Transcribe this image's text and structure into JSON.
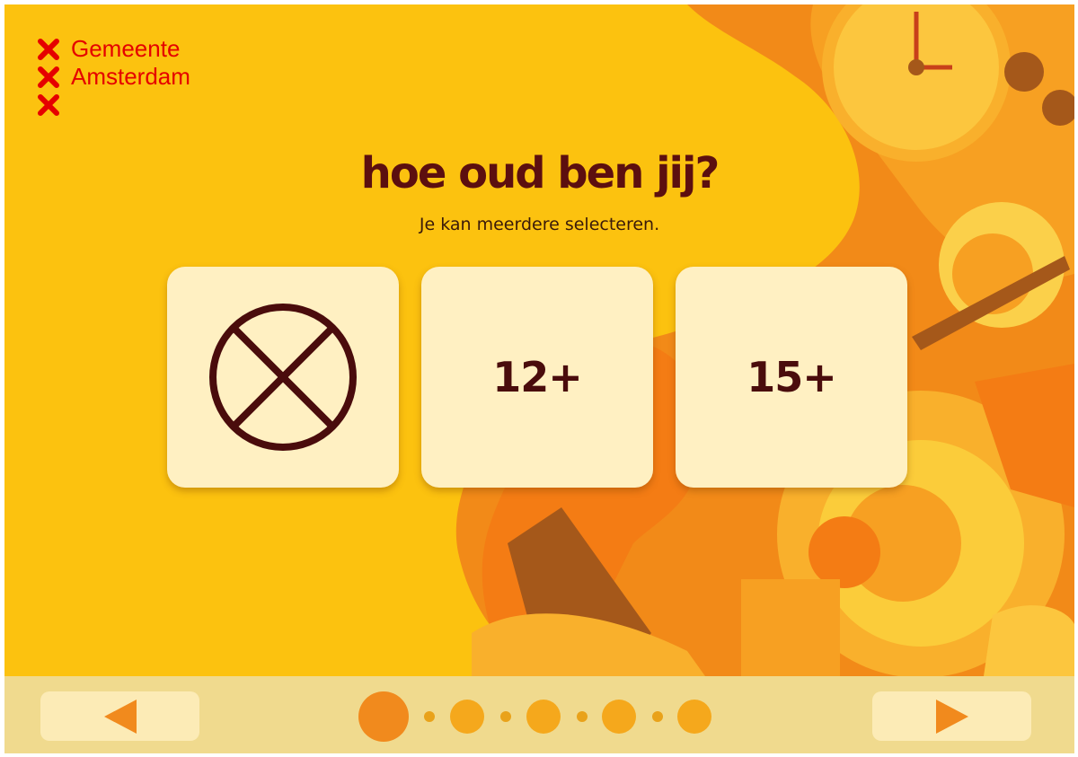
{
  "brand": {
    "line1": "Gemeente",
    "line2": "Amsterdam",
    "color": "#E50000",
    "icon": "x-mark-icon"
  },
  "question": {
    "title": "hoe oud ben jij?",
    "subtitle": "Je kan meerdere selecteren."
  },
  "options": [
    {
      "id": "none",
      "label": "",
      "icon": "circle-x-icon"
    },
    {
      "id": "12plus",
      "label": "12+"
    },
    {
      "id": "15plus",
      "label": "15+"
    }
  ],
  "navigation": {
    "prev_icon": "triangle-left-icon",
    "next_icon": "triangle-right-icon",
    "total_steps": 5,
    "current_step": 1
  },
  "colors": {
    "background": "#FCC20F",
    "card": "#FFF0C2",
    "text_dark": "#5C0F0F",
    "accent_orange": "#F18A1D",
    "bar": "#F0DA8E"
  }
}
